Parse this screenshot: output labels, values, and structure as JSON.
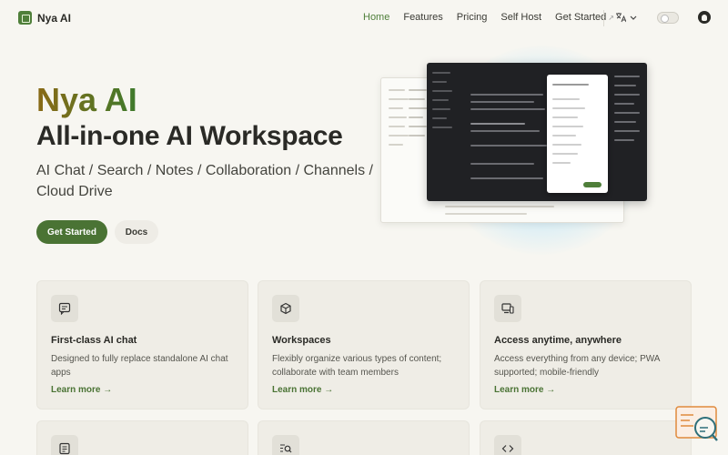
{
  "brand": {
    "name": "Nya AI",
    "accent": "#4f7f3a"
  },
  "nav": {
    "links": [
      {
        "label": "Home",
        "active": true
      },
      {
        "label": "Features"
      },
      {
        "label": "Pricing"
      },
      {
        "label": "Self Host"
      },
      {
        "label": "Get Started"
      }
    ],
    "external_marker": "↗"
  },
  "hero": {
    "title": "Nya AI",
    "subtitle": "All-in-one AI Workspace",
    "description": "AI Chat / Search / Notes / Collaboration / Channels / Cloud Drive",
    "primary_button": "Get Started",
    "secondary_button": "Docs"
  },
  "features": [
    {
      "icon": "chat-icon",
      "title": "First-class AI chat",
      "desc": "Designed to fully replace standalone AI chat apps",
      "link": "Learn more"
    },
    {
      "icon": "cube-icon",
      "title": "Workspaces",
      "desc": "Flexibly organize various types of content; collaborate with team members",
      "link": "Learn more"
    },
    {
      "icon": "devices-icon",
      "title": "Access anytime, anywhere",
      "desc": "Access everything from any device; PWA supported; mobile-friendly",
      "link": "Learn more"
    },
    {
      "icon": "document-icon"
    },
    {
      "icon": "search-list-icon"
    },
    {
      "icon": "code-icon"
    }
  ]
}
